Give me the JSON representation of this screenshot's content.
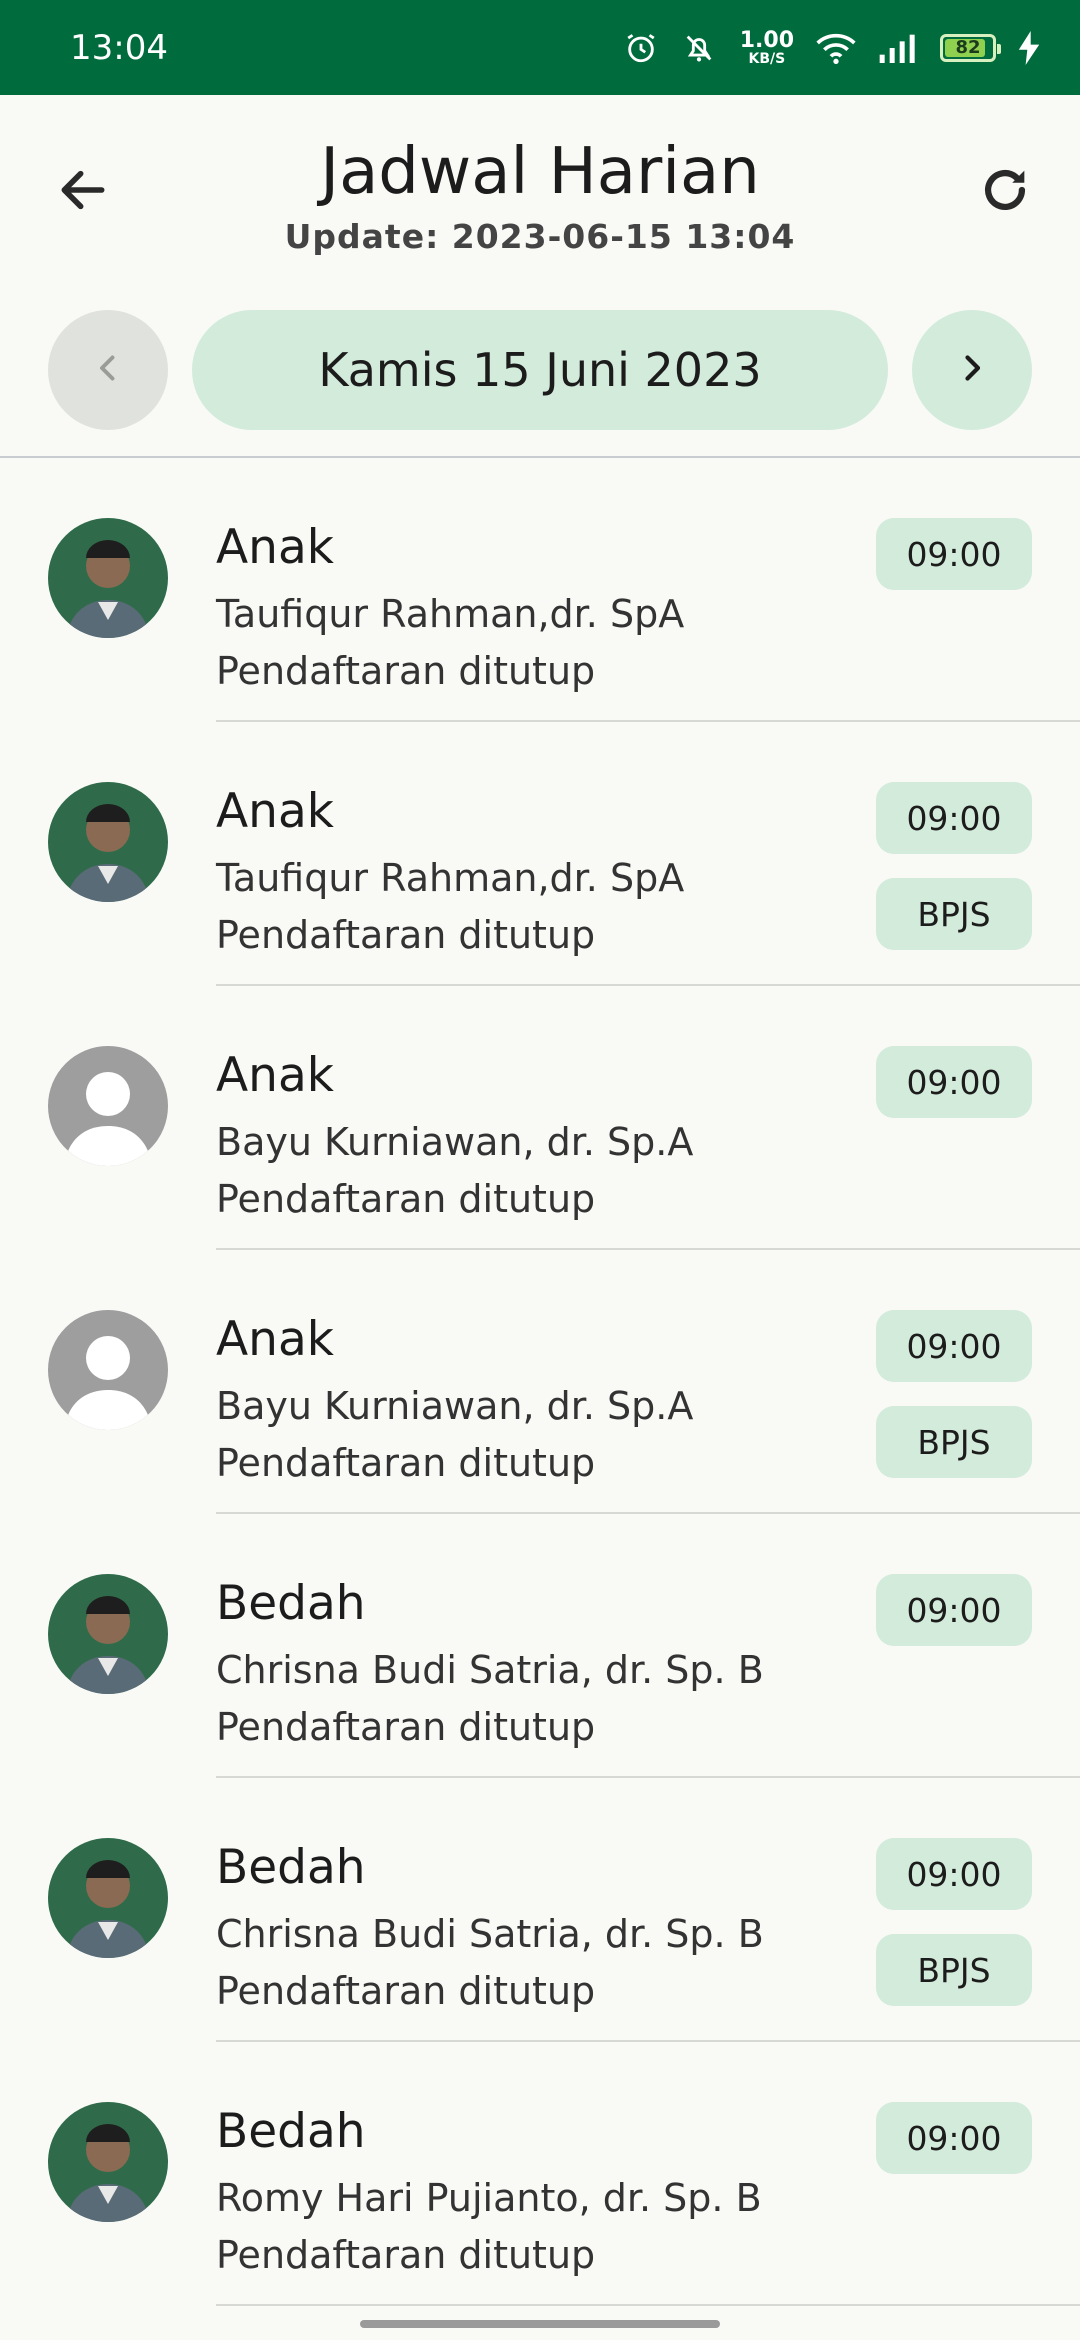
{
  "status_bar": {
    "time": "13:04",
    "net_speed_value": "1.00",
    "net_speed_unit": "KB/S",
    "battery": "82",
    "color": "#006b3c"
  },
  "header": {
    "title": "Jadwal Harian",
    "update": "Update: 2023-06-15 13:04",
    "back_icon": "arrow-left-icon",
    "refresh_icon": "refresh-icon"
  },
  "date_nav": {
    "date_label": "Kamis 15 Juni 2023",
    "prev_icon": "chevron-left-icon",
    "next_icon": "chevron-right-icon"
  },
  "accent": "#d3ebdb",
  "schedules": [
    {
      "specialty": "Anak",
      "doctor": "Taufiqur Rahman,dr. SpA",
      "status": "Pendaftaran ditutup",
      "time": "09:00",
      "bpjs": "",
      "avatar": "photo"
    },
    {
      "specialty": "Anak",
      "doctor": "Taufiqur Rahman,dr. SpA",
      "status": "Pendaftaran ditutup",
      "time": "09:00",
      "bpjs": "BPJS",
      "avatar": "photo"
    },
    {
      "specialty": "Anak",
      "doctor": "Bayu Kurniawan, dr. Sp.A",
      "status": "Pendaftaran ditutup",
      "time": "09:00",
      "bpjs": "",
      "avatar": "placeholder"
    },
    {
      "specialty": "Anak",
      "doctor": "Bayu Kurniawan, dr. Sp.A",
      "status": "Pendaftaran ditutup",
      "time": "09:00",
      "bpjs": "BPJS",
      "avatar": "placeholder"
    },
    {
      "specialty": "Bedah",
      "doctor": "Chrisna Budi Satria, dr. Sp. B",
      "status": "Pendaftaran ditutup",
      "time": "09:00",
      "bpjs": "",
      "avatar": "photo"
    },
    {
      "specialty": "Bedah",
      "doctor": "Chrisna Budi Satria, dr. Sp. B",
      "status": "Pendaftaran ditutup",
      "time": "09:00",
      "bpjs": "BPJS",
      "avatar": "photo"
    },
    {
      "specialty": "Bedah",
      "doctor": "Romy Hari Pujianto, dr. Sp. B",
      "status": "Pendaftaran ditutup",
      "time": "09:00",
      "bpjs": "",
      "avatar": "photo"
    }
  ]
}
